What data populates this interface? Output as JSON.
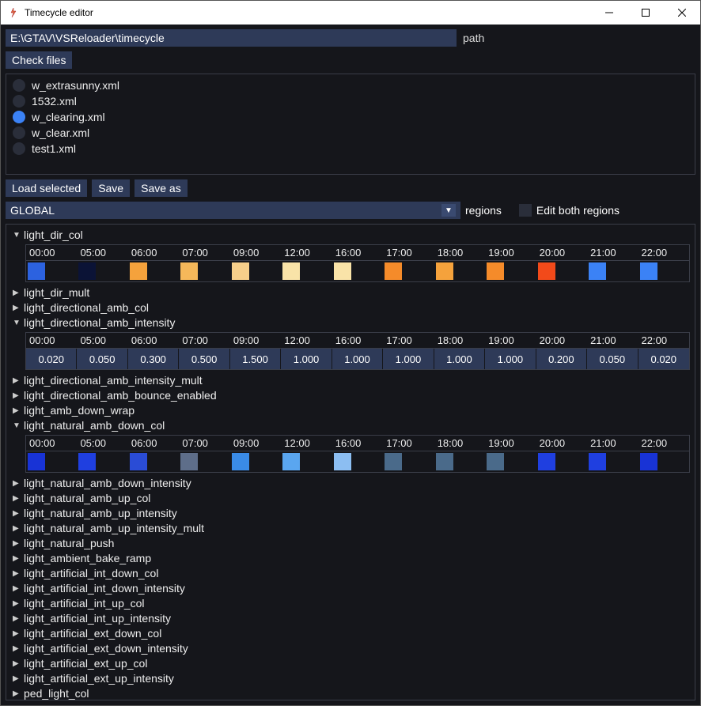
{
  "window": {
    "title": "Timecycle editor"
  },
  "path": {
    "value": "E:\\GTAV\\VSReloader\\timecycle",
    "label": "path"
  },
  "buttons": {
    "check_files": "Check files",
    "load_selected": "Load selected",
    "save": "Save",
    "save_as": "Save as"
  },
  "files": [
    {
      "name": "w_extrasunny.xml",
      "selected": false
    },
    {
      "name": "1532.xml",
      "selected": false
    },
    {
      "name": "w_clearing.xml",
      "selected": true
    },
    {
      "name": "w_clear.xml",
      "selected": false
    },
    {
      "name": "test1.xml",
      "selected": false
    }
  ],
  "region": {
    "selected": "GLOBAL",
    "label": "regions",
    "edit_both_label": "Edit both regions"
  },
  "time_headers": [
    "00:00",
    "05:00",
    "06:00",
    "07:00",
    "09:00",
    "12:00",
    "16:00",
    "17:00",
    "18:00",
    "19:00",
    "20:00",
    "21:00",
    "22:00"
  ],
  "params": [
    {
      "name": "light_dir_col",
      "expanded": true,
      "type": "color",
      "values": [
        "#2c62e0",
        "#0b1336",
        "#f5a23c",
        "#f5b85a",
        "#f7cf8a",
        "#f9e3a8",
        "#f9e3a8",
        "#f58b2a",
        "#f5a23c",
        "#f58b2a",
        "#f24a1a",
        "#3b82f6",
        "#3b82f6"
      ]
    },
    {
      "name": "light_dir_mult",
      "expanded": false
    },
    {
      "name": "light_directional_amb_col",
      "expanded": false
    },
    {
      "name": "light_directional_amb_intensity",
      "expanded": true,
      "type": "number",
      "values": [
        "0.020",
        "0.050",
        "0.300",
        "0.500",
        "1.500",
        "1.000",
        "1.000",
        "1.000",
        "1.000",
        "1.000",
        "0.200",
        "0.050",
        "0.020"
      ]
    },
    {
      "name": "light_directional_amb_intensity_mult",
      "expanded": false
    },
    {
      "name": "light_directional_amb_bounce_enabled",
      "expanded": false
    },
    {
      "name": "light_amb_down_wrap",
      "expanded": false
    },
    {
      "name": "light_natural_amb_down_col",
      "expanded": true,
      "type": "color",
      "values": [
        "#1833d6",
        "#1f3fe0",
        "#2a4cd6",
        "#5e6e8a",
        "#3a8be6",
        "#5aa6f0",
        "#8cbef2",
        "#4a6a8a",
        "#4a6a8a",
        "#4a6a8a",
        "#1f3fe0",
        "#1f3fe0",
        "#1833d6"
      ]
    },
    {
      "name": "light_natural_amb_down_intensity",
      "expanded": false
    },
    {
      "name": "light_natural_amb_up_col",
      "expanded": false
    },
    {
      "name": "light_natural_amb_up_intensity",
      "expanded": false
    },
    {
      "name": "light_natural_amb_up_intensity_mult",
      "expanded": false
    },
    {
      "name": "light_natural_push",
      "expanded": false
    },
    {
      "name": "light_ambient_bake_ramp",
      "expanded": false
    },
    {
      "name": "light_artificial_int_down_col",
      "expanded": false
    },
    {
      "name": "light_artificial_int_down_intensity",
      "expanded": false
    },
    {
      "name": "light_artificial_int_up_col",
      "expanded": false
    },
    {
      "name": "light_artificial_int_up_intensity",
      "expanded": false
    },
    {
      "name": "light_artificial_ext_down_col",
      "expanded": false
    },
    {
      "name": "light_artificial_ext_down_intensity",
      "expanded": false
    },
    {
      "name": "light_artificial_ext_up_col",
      "expanded": false
    },
    {
      "name": "light_artificial_ext_up_intensity",
      "expanded": false
    },
    {
      "name": "ped_light_col",
      "expanded": false
    }
  ]
}
